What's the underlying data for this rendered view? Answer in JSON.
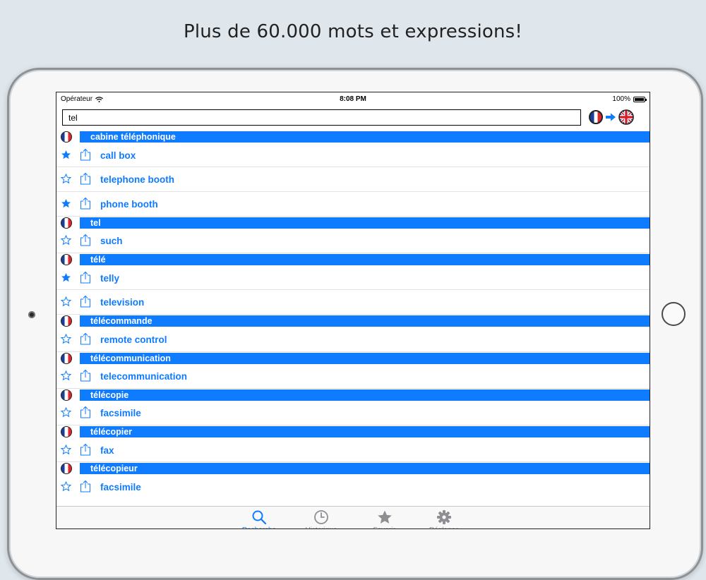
{
  "headline": "Plus de 60.000 mots et expressions!",
  "status": {
    "carrier": "Opérateur",
    "time": "8:08 PM",
    "battery": "100%"
  },
  "search": {
    "value": "tel"
  },
  "languages": {
    "from": "French",
    "to": "English"
  },
  "colors": {
    "accent": "#0f7bff",
    "starred": "#0f7bff"
  },
  "results": [
    {
      "headword": "cabine téléphonique",
      "translations": [
        {
          "term": "call box",
          "starred": true
        },
        {
          "term": "telephone booth",
          "starred": false
        },
        {
          "term": "phone booth",
          "starred": true
        }
      ]
    },
    {
      "headword": "tel",
      "translations": [
        {
          "term": "such",
          "starred": false
        }
      ]
    },
    {
      "headword": "télé",
      "translations": [
        {
          "term": "telly",
          "starred": true
        },
        {
          "term": "television",
          "starred": false
        }
      ]
    },
    {
      "headword": "télécommande",
      "translations": [
        {
          "term": "remote control",
          "starred": false
        }
      ]
    },
    {
      "headword": "télécommunication",
      "translations": [
        {
          "term": "telecommunication",
          "starred": false
        }
      ]
    },
    {
      "headword": "télécopie",
      "translations": [
        {
          "term": "facsimile",
          "starred": false
        }
      ]
    },
    {
      "headword": "télécopier",
      "translations": [
        {
          "term": "fax",
          "starred": false
        }
      ]
    },
    {
      "headword": "télécopieur",
      "translations": [
        {
          "term": "facsimile",
          "starred": false
        }
      ]
    }
  ],
  "tabs": [
    {
      "label": "Recherche",
      "icon": "search-icon",
      "active": true
    },
    {
      "label": "Historique",
      "icon": "clock-icon",
      "active": false
    },
    {
      "label": "Favoris",
      "icon": "star-icon",
      "active": false
    },
    {
      "label": "Réglages",
      "icon": "gear-icon",
      "active": false
    }
  ]
}
